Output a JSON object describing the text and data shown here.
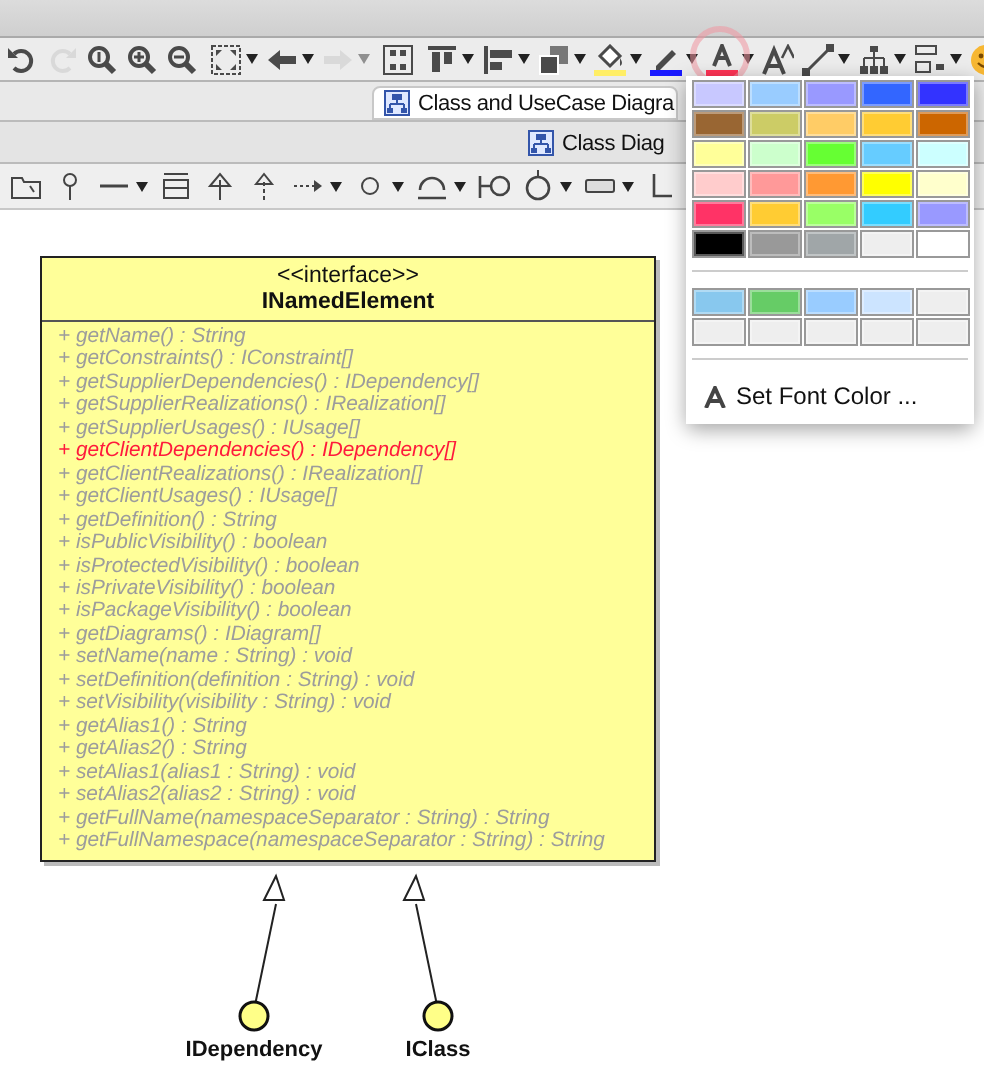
{
  "toolbar": [
    {
      "kind": "undo",
      "disabled": false,
      "menu": false,
      "open": false
    },
    {
      "kind": "redo",
      "disabled": true,
      "menu": false,
      "open": false
    },
    {
      "kind": "zoom-actual",
      "disabled": false,
      "menu": false,
      "open": false
    },
    {
      "kind": "zoom-in",
      "disabled": false,
      "menu": false,
      "open": false
    },
    {
      "kind": "zoom-out",
      "disabled": false,
      "menu": false,
      "open": false
    },
    {
      "kind": "fit",
      "disabled": false,
      "menu": true,
      "open": false
    },
    {
      "kind": "back",
      "disabled": false,
      "menu": true,
      "open": false
    },
    {
      "kind": "forward",
      "disabled": true,
      "menu": true,
      "open": false
    },
    {
      "kind": "layout",
      "disabled": false,
      "menu": false,
      "open": false
    },
    {
      "kind": "align-top",
      "disabled": false,
      "menu": true,
      "open": false
    },
    {
      "kind": "align-left",
      "disabled": false,
      "menu": true,
      "open": false
    },
    {
      "kind": "arrange",
      "disabled": false,
      "menu": true,
      "open": false
    },
    {
      "kind": "fill",
      "disabled": false,
      "menu": true,
      "open": false
    },
    {
      "kind": "line-color",
      "disabled": false,
      "menu": true,
      "open": false
    },
    {
      "kind": "font-color",
      "disabled": false,
      "menu": true,
      "open": true
    },
    {
      "kind": "font-size",
      "disabled": false,
      "menu": false,
      "open": false
    },
    {
      "kind": "connector",
      "disabled": false,
      "menu": true,
      "open": false
    },
    {
      "kind": "tree",
      "disabled": false,
      "menu": true,
      "open": false
    },
    {
      "kind": "shape-layout",
      "disabled": false,
      "menu": true,
      "open": false
    },
    {
      "kind": "smiley",
      "disabled": false,
      "menu": false,
      "open": false
    }
  ],
  "tabs": [
    {
      "label": "Class and UseCase Diagra",
      "selected": true
    }
  ],
  "subtabs": [
    {
      "label": "Class Diag",
      "selected": true
    }
  ],
  "diagram_toolbar": [
    {
      "kind": "package",
      "menu": false
    },
    {
      "kind": "pin",
      "menu": false
    },
    {
      "kind": "line",
      "menu": true
    },
    {
      "kind": "class",
      "menu": false
    },
    {
      "kind": "generalization",
      "menu": false
    },
    {
      "kind": "realization",
      "menu": false
    },
    {
      "kind": "dependency",
      "menu": true
    },
    {
      "kind": "interface",
      "menu": true
    },
    {
      "kind": "required",
      "menu": true
    },
    {
      "kind": "provided",
      "menu": false
    },
    {
      "kind": "cycle",
      "menu": true
    },
    {
      "kind": "rectangle",
      "menu": true
    },
    {
      "kind": "corner",
      "menu": false
    }
  ],
  "class": {
    "stereotype": "<<interface>>",
    "name": "INamedElement",
    "members": [
      {
        "text": "+ getName() : String",
        "highlighted": false
      },
      {
        "text": "+ getConstraints() : IConstraint[]",
        "highlighted": false
      },
      {
        "text": "+ getSupplierDependencies() : IDependency[]",
        "highlighted": false
      },
      {
        "text": "+ getSupplierRealizations() : IRealization[]",
        "highlighted": false
      },
      {
        "text": "+ getSupplierUsages() : IUsage[]",
        "highlighted": false
      },
      {
        "text": "+ getClientDependencies() : IDependency[]",
        "highlighted": true
      },
      {
        "text": "+ getClientRealizations() : IRealization[]",
        "highlighted": false
      },
      {
        "text": "+ getClientUsages() : IUsage[]",
        "highlighted": false
      },
      {
        "text": "+ getDefinition() : String",
        "highlighted": false
      },
      {
        "text": "+ isPublicVisibility() : boolean",
        "highlighted": false
      },
      {
        "text": "+ isProtectedVisibility() : boolean",
        "highlighted": false
      },
      {
        "text": "+ isPrivateVisibility() : boolean",
        "highlighted": false
      },
      {
        "text": "+ isPackageVisibility() : boolean",
        "highlighted": false
      },
      {
        "text": "+ getDiagrams() : IDiagram[]",
        "highlighted": false
      },
      {
        "text": "+ setName(name : String) : void",
        "highlighted": false
      },
      {
        "text": "+ setDefinition(definition : String) : void",
        "highlighted": false
      },
      {
        "text": "+ setVisibility(visibility : String) : void",
        "highlighted": false
      },
      {
        "text": "+ getAlias1() : String",
        "highlighted": false
      },
      {
        "text": "+ getAlias2() : String",
        "highlighted": false
      },
      {
        "text": "+ setAlias1(alias1 : String) : void",
        "highlighted": false
      },
      {
        "text": "+ setAlias2(alias2 : String) : void",
        "highlighted": false
      },
      {
        "text": "+ getFullName(namespaceSeparator : String) : String",
        "highlighted": false
      },
      {
        "text": "+ getFullNamespace(namespaceSeparator : String) : String",
        "highlighted": false
      }
    ]
  },
  "interfaces": [
    {
      "name": "IDependency"
    },
    {
      "name": "IClass"
    }
  ],
  "color_menu": {
    "swatches": [
      {
        "color": "#c8c8ff"
      },
      {
        "color": "#99ccff"
      },
      {
        "color": "#9999ff"
      },
      {
        "color": "#3366ff"
      },
      {
        "color": "#3333ff"
      },
      {
        "color": "#996633"
      },
      {
        "color": "#cccc66"
      },
      {
        "color": "#ffcc66"
      },
      {
        "color": "#ffcc33"
      },
      {
        "color": "#cc6600"
      },
      {
        "color": "#ffff99"
      },
      {
        "color": "#ccffcc"
      },
      {
        "color": "#66ff33"
      },
      {
        "color": "#66ccff"
      },
      {
        "color": "#ccffff"
      },
      {
        "color": "#ffcccc"
      },
      {
        "color": "#ff9999"
      },
      {
        "color": "#ff9933"
      },
      {
        "color": "#ffff00"
      },
      {
        "color": "#ffffcc"
      },
      {
        "color": "#ff3366"
      },
      {
        "color": "#ffcc33"
      },
      {
        "color": "#99ff66"
      },
      {
        "color": "#33ccff"
      },
      {
        "color": "#9999ff"
      },
      {
        "color": "#000000"
      },
      {
        "color": "#999999"
      },
      {
        "color": "#a0a6a8"
      },
      {
        "color": "#eeeeee"
      },
      {
        "color": "#ffffff"
      }
    ],
    "recent": [
      {
        "color": "#88c8ee"
      },
      {
        "color": "#66cc66"
      },
      {
        "color": "#99ccff"
      },
      {
        "color": "#cce4ff"
      },
      {
        "color": "#eeeeee"
      },
      {
        "color": "#eeeeee"
      },
      {
        "color": "#eeeeee"
      },
      {
        "color": "#eeeeee"
      },
      {
        "color": "#eeeeee"
      },
      {
        "color": "#eeeeee"
      }
    ],
    "item": "Set Font Color ..."
  }
}
